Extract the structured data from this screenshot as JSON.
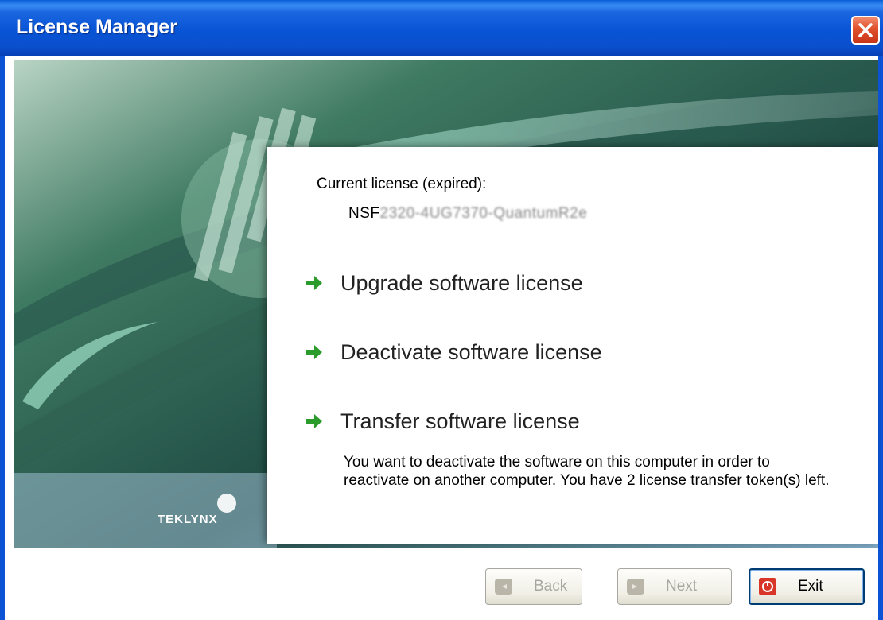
{
  "window": {
    "title": "License Manager"
  },
  "brand": {
    "name": "TEKLYNX"
  },
  "license": {
    "label": "Current license (expired):",
    "key_visible": "NSF",
    "key_redacted": "2⁠3⁠2⁠0⁠-⁠4⁠U⁠G⁠7⁠3⁠7⁠0⁠-⁠Q⁠u⁠a⁠n⁠t⁠u⁠m⁠R⁠2⁠e⁠"
  },
  "actions": [
    {
      "label": "Upgrade software license"
    },
    {
      "label": "Deactivate software license"
    },
    {
      "label": "Transfer software license"
    }
  ],
  "transfer_description": "You want to deactivate the software on this computer in order to reactivate on another computer. You have 2 license transfer token(s) left.",
  "buttons": {
    "back": "Back",
    "next": "Next",
    "exit": "Exit"
  },
  "colors": {
    "titlebar": "#0a5fd8",
    "arrow": "#2b9b2b",
    "close": "#e0502a"
  }
}
